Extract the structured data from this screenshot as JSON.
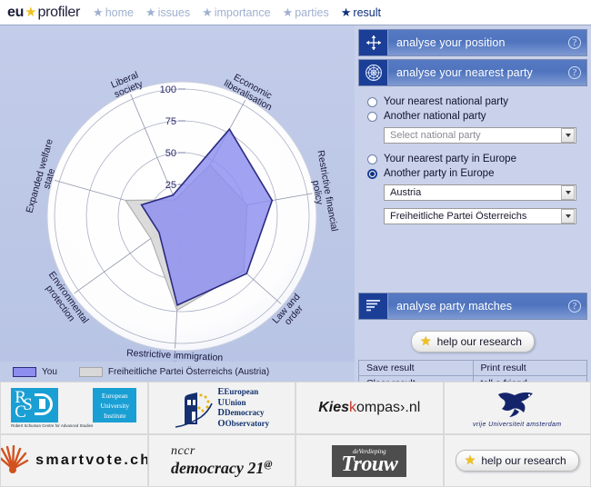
{
  "header": {
    "logo": {
      "part1": "eu",
      "star": "★",
      "part2": "profiler"
    },
    "nav": [
      {
        "label": "home",
        "icon": "star-icon",
        "active": false
      },
      {
        "label": "issues",
        "icon": "star-icon",
        "active": false
      },
      {
        "label": "importance",
        "icon": "star-icon",
        "active": false
      },
      {
        "label": "parties",
        "icon": "star-icon",
        "active": false
      },
      {
        "label": "result",
        "icon": "star-icon",
        "active": true
      }
    ]
  },
  "chart_data": {
    "type": "radar",
    "title": "",
    "categories": [
      "Economic liberalisation",
      "Restrictive financial policy",
      "Law and order",
      "Restrictive immigration policy",
      "Environmental protection",
      "Expanded welfare state",
      "Liberal society"
    ],
    "tick_labels": [
      "25",
      "50",
      "75",
      "100"
    ],
    "ticks": [
      25,
      50,
      75,
      100
    ],
    "rlim": [
      0,
      100
    ],
    "grid": true,
    "legend_position": "below",
    "series": [
      {
        "name": "You",
        "color": "#8d8df0",
        "line_color": "#2b2b80",
        "values": [
          78,
          72,
          68,
          70,
          22,
          33,
          18
        ]
      },
      {
        "name": "Freiheitliche Partei Österreichs (Austria)",
        "color": "#d8d8d8",
        "line_color": "#b0b0b0",
        "values": [
          46,
          52,
          65,
          74,
          30,
          46,
          14
        ]
      }
    ]
  },
  "legend": {
    "you_label": "You",
    "party_label": "Freiheitliche Partei Österreichs (Austria)"
  },
  "panels": {
    "position": {
      "title": "analyse your position",
      "icon": "move-arrows-icon",
      "help": "?"
    },
    "nearest_party": {
      "title": "analyse your nearest party",
      "icon": "radar-target-icon",
      "help": "?"
    },
    "matches": {
      "title": "analyse party matches",
      "icon": "bar-list-icon",
      "help": "?"
    }
  },
  "form": {
    "radios": [
      {
        "label": "Your nearest national  party",
        "selected": false
      },
      {
        "label": "Another national party",
        "selected": false
      },
      {
        "label": "Your nearest party in Europe",
        "selected": false
      },
      {
        "label": "Another party in Europe",
        "selected": true
      }
    ],
    "national_party_select": {
      "value": "Select national party",
      "placeholder": true
    },
    "country_select": {
      "value": "Austria",
      "placeholder": false
    },
    "europe_party_select": {
      "value": "Freiheitliche Partei Österreichs",
      "placeholder": false
    }
  },
  "actions": {
    "help_research": "help our research",
    "help_research_footer": "help our research",
    "links": [
      [
        "Save result",
        "Print result"
      ],
      [
        "Clear result",
        "tell a friend"
      ]
    ]
  },
  "footer": {
    "rsc": {
      "r": "R",
      "s": "S",
      "c": "C",
      "sub": "Robert Schuman Centre for Advanced Studies",
      "eui_l1": "European",
      "eui_l2": "University",
      "eui_l3": "Institute"
    },
    "eudo": {
      "l1": "European",
      "l2": "Union",
      "l3": "Democracy",
      "l4": "Observatory"
    },
    "smartvote": {
      "text": "smartvote.ch"
    },
    "nccr": {
      "l1": "nccr",
      "l2": "democracy 21",
      "at": "@"
    },
    "kieskompas": {
      "pre": "Kies",
      "mid": "k",
      "post": "ompas›.nl"
    },
    "vu": {
      "text": "vrije Universiteit   amsterdam"
    },
    "trouw": {
      "sup": "deVerdieping",
      "main": "Trouw"
    }
  }
}
